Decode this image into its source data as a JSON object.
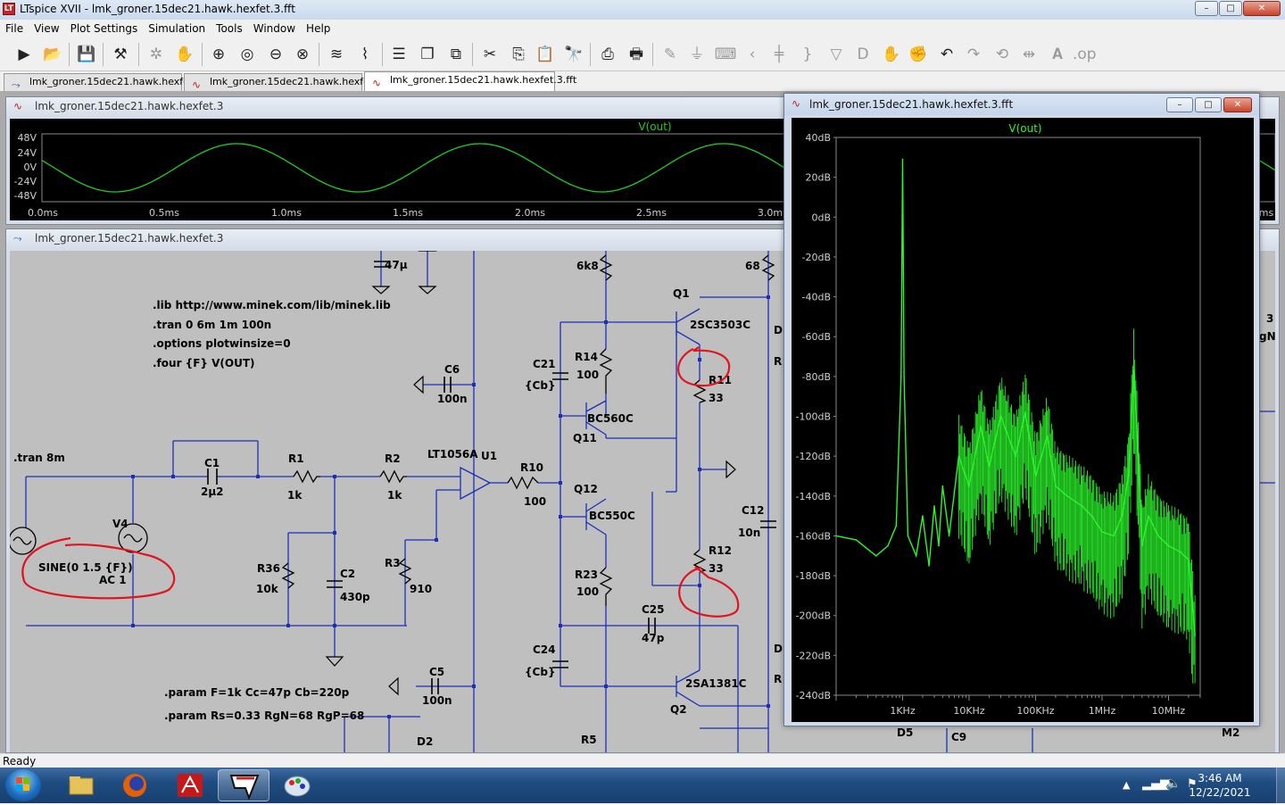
{
  "window": {
    "title": "LTspice XVII - lmk_groner.15dec21.hawk.hexfet.3.fft",
    "controls": [
      "–",
      "□",
      "✕"
    ]
  },
  "menu": [
    "File",
    "View",
    "Plot Settings",
    "Simulation",
    "Tools",
    "Window",
    "Help"
  ],
  "toolbar": {
    "icons": [
      "run-icon",
      "open-icon",
      "save-icon",
      "control-panel-icon",
      "halt-icon",
      "pan-icon",
      "zoom-in-icon",
      "zoom-box-icon",
      "zoom-out-icon",
      "zoom-cancel-icon",
      "autorange-icon",
      "mark-data-icon",
      "tile-horizontal-icon",
      "cascade-icon",
      "tile-vertical-icon",
      "cut-icon",
      "copy-icon",
      "paste-icon",
      "find-icon",
      "print-icon",
      "print-setup-icon",
      "draw-wire-icon",
      "ground-icon",
      "label-net-icon",
      "resistor-icon",
      "capacitor-icon",
      "inductor-icon",
      "diode-icon",
      "component-icon",
      "move-icon",
      "drag-icon",
      "undo-icon",
      "redo-icon",
      "rotate-icon",
      "mirror-icon",
      "text-icon",
      "spice-directive-icon"
    ]
  },
  "tabs": [
    {
      "label": "lmk_groner.15dec21.hawk.hexfet.3",
      "kind": "schematic"
    },
    {
      "label": "lmk_groner.15dec21.hawk.hexfet.3",
      "kind": "waveform"
    },
    {
      "label": "lmk_groner.15dec21.hawk.hexfet.3.fft",
      "kind": "waveform",
      "active": true
    }
  ],
  "transient_window": {
    "title": "lmk_groner.15dec21.hawk.hexfet.3",
    "trace_label": "V(out)",
    "yticks": [
      "48V",
      "24V",
      "0V",
      "-24V",
      "-48V"
    ],
    "xticks": [
      "0.0ms",
      "0.5ms",
      "1.0ms",
      "1.5ms",
      "2.0ms",
      "2.5ms",
      "3.0m"
    ],
    "right_clip": "ms",
    "trace_color": "#1fcf1f"
  },
  "schematic_window": {
    "title": "lmk_groner.15dec21.hawk.hexfet.3",
    "directives": [
      ".lib http://www.minek.com/lib/minek.lib",
      ".tran 0 6m 1m 100n",
      ".options plotwinsize=0",
      ".four {F} V(OUT)"
    ],
    "tran_label": ".tran 8m",
    "params": [
      ".param F=1k Cc=47p Cb=220p",
      ".param Rs=0.33 RgN=68 RgP=68"
    ],
    "source": {
      "name": "V4",
      "value": "SINE(0 1.5 {F})",
      "ac": "AC 1"
    },
    "parts": {
      "C1": "C1",
      "C1v": "2µ2",
      "R1": "R1",
      "R1v": "1k",
      "R2": "R2",
      "R2v": "1k",
      "U1": "U1",
      "U1v": "LT1056A",
      "R10": "R10",
      "R10v": "100",
      "R36": "R36",
      "R36v": "10k",
      "C2": "C2",
      "C2v": "430p",
      "R3": "R3",
      "R3v": "910",
      "C6": "C6",
      "C6v": "100n",
      "C5": "C5",
      "C5v": "100n",
      "Ctop": "47µ",
      "R6k8": "6k8",
      "C21": "C21",
      "C21v": "{Cb}",
      "R14": "R14",
      "R14v": "100",
      "Q11": "Q11",
      "Q11v": "BC560C",
      "Q12": "Q12",
      "Q12v": "BC550C",
      "R23": "R23",
      "R23v": "100",
      "C24": "C24",
      "C24v": "{Cb}",
      "C25": "C25",
      "C25v": "47p",
      "Q1": "Q1",
      "Q1v": "2SC3503C",
      "R11": "R11",
      "R11v": "33",
      "R12": "R12",
      "R12v": "33",
      "Q2": "Q2",
      "Q2v": "2SA1381C",
      "C12": "C12",
      "C12v": "10n",
      "R5": "R5",
      "R68": "68",
      "D5": "D5",
      "C9": "C9",
      "M2": "M2",
      "D2": "D2",
      "clipD": "D",
      "clipR": "R",
      "clipD2": "D",
      "clipR2": "R",
      "clip3": "3",
      "clipGN": "gN]"
    },
    "annotation_color": "#e0141e",
    "wire_color": "#1a2fb8"
  },
  "fft_window": {
    "title": "lmk_groner.15dec21.hawk.hexfet.3.fft",
    "trace_label": "V(out)",
    "trace_color": "#2cf52c"
  },
  "chart_data": {
    "type": "line",
    "title": "V(out)",
    "xlabel": "",
    "ylabel": "",
    "xscale": "log",
    "xlim": [
      100,
      30000000
    ],
    "ylim": [
      -240,
      40
    ],
    "yticks": [
      "40dB",
      "20dB",
      "0dB",
      "-20dB",
      "-40dB",
      "-60dB",
      "-80dB",
      "-100dB",
      "-120dB",
      "-140dB",
      "-160dB",
      "-180dB",
      "-200dB",
      "-220dB",
      "-240dB"
    ],
    "xticks": [
      "1KHz",
      "10KHz",
      "100KHz",
      "1MHz",
      "10MHz"
    ],
    "series": [
      {
        "name": "V(out)",
        "x": [
          100,
          200,
          400,
          600,
          800,
          950,
          1000,
          1050,
          1200,
          1600,
          2000,
          2500,
          3000,
          3500,
          4000,
          5000,
          7000,
          10000,
          15000,
          20000,
          30000,
          50000,
          70000,
          100000,
          150000,
          200000,
          300000,
          500000,
          700000,
          1000000,
          1500000,
          2000000,
          2500000,
          3000000,
          3500000,
          4000000,
          5000000,
          7000000,
          10000000,
          15000000,
          20000000,
          25000000
        ],
        "y": [
          -160,
          -162,
          -170,
          -165,
          -155,
          -80,
          29,
          -80,
          -160,
          -170,
          -150,
          -175,
          -145,
          -165,
          -135,
          -160,
          -120,
          -135,
          -105,
          -125,
          -100,
          -120,
          -98,
          -130,
          -110,
          -135,
          -140,
          -145,
          -150,
          -158,
          -160,
          -150,
          -130,
          -77,
          -120,
          -165,
          -150,
          -160,
          -165,
          -168,
          -172,
          -210
        ]
      }
    ],
    "grid": false,
    "legend": "none"
  },
  "desktop": {
    "status": "Ready",
    "time": "3:46 AM",
    "date": "12/22/2021",
    "taskbar_apps": [
      "windows-explorer-icon",
      "firefox-icon",
      "acrobat-icon",
      "ltspice-icon",
      "paint-icon"
    ]
  }
}
